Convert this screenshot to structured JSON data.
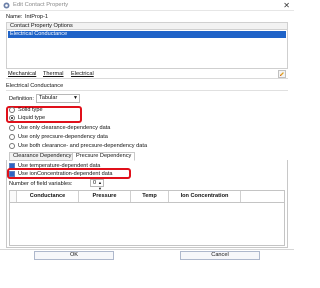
{
  "window": {
    "title": "Edit Contact Property",
    "close_glyph": "✕"
  },
  "name": {
    "label": "Name:",
    "value": "IntProp-1"
  },
  "contact_options": {
    "header": "Contact Property Options",
    "items": [
      "Electrical Conductance"
    ]
  },
  "menu": {
    "items": [
      "Mechanical",
      "Thermal",
      "Electrical"
    ],
    "icon": "pencil-icon"
  },
  "section": {
    "title": "Electrical Conductance"
  },
  "definition": {
    "label": "Definition:",
    "value": "Tabular"
  },
  "phase_radios": [
    {
      "label": "Solid type",
      "checked": false
    },
    {
      "label": "Liquid type",
      "checked": true
    }
  ],
  "dependency_radios": [
    {
      "label": "Use only clearance-dependency data",
      "checked": false
    },
    {
      "label": "Use only precsure-dependency data",
      "checked": false
    },
    {
      "label": "Use both clearance- and precsure-dependency data",
      "checked": false
    }
  ],
  "tabs": [
    {
      "label": "Clearance Dependency",
      "active": false
    },
    {
      "label": "Precsure Dependency",
      "active": true
    }
  ],
  "checkboxes": [
    {
      "label": "Use temperature-dependent data",
      "checked": true
    },
    {
      "label": "Use ionConcentration-dependent data",
      "checked": true
    }
  ],
  "field_variables": {
    "label": "Number of field variables:",
    "value": "0"
  },
  "table": {
    "columns": [
      "Conductance",
      "Pressure",
      "Temp",
      "Ion Concentration"
    ]
  },
  "buttons": {
    "ok": "OK",
    "cancel": "Cancel"
  },
  "colors": {
    "highlight": "#e0101a",
    "selection": "#1f63c8"
  }
}
